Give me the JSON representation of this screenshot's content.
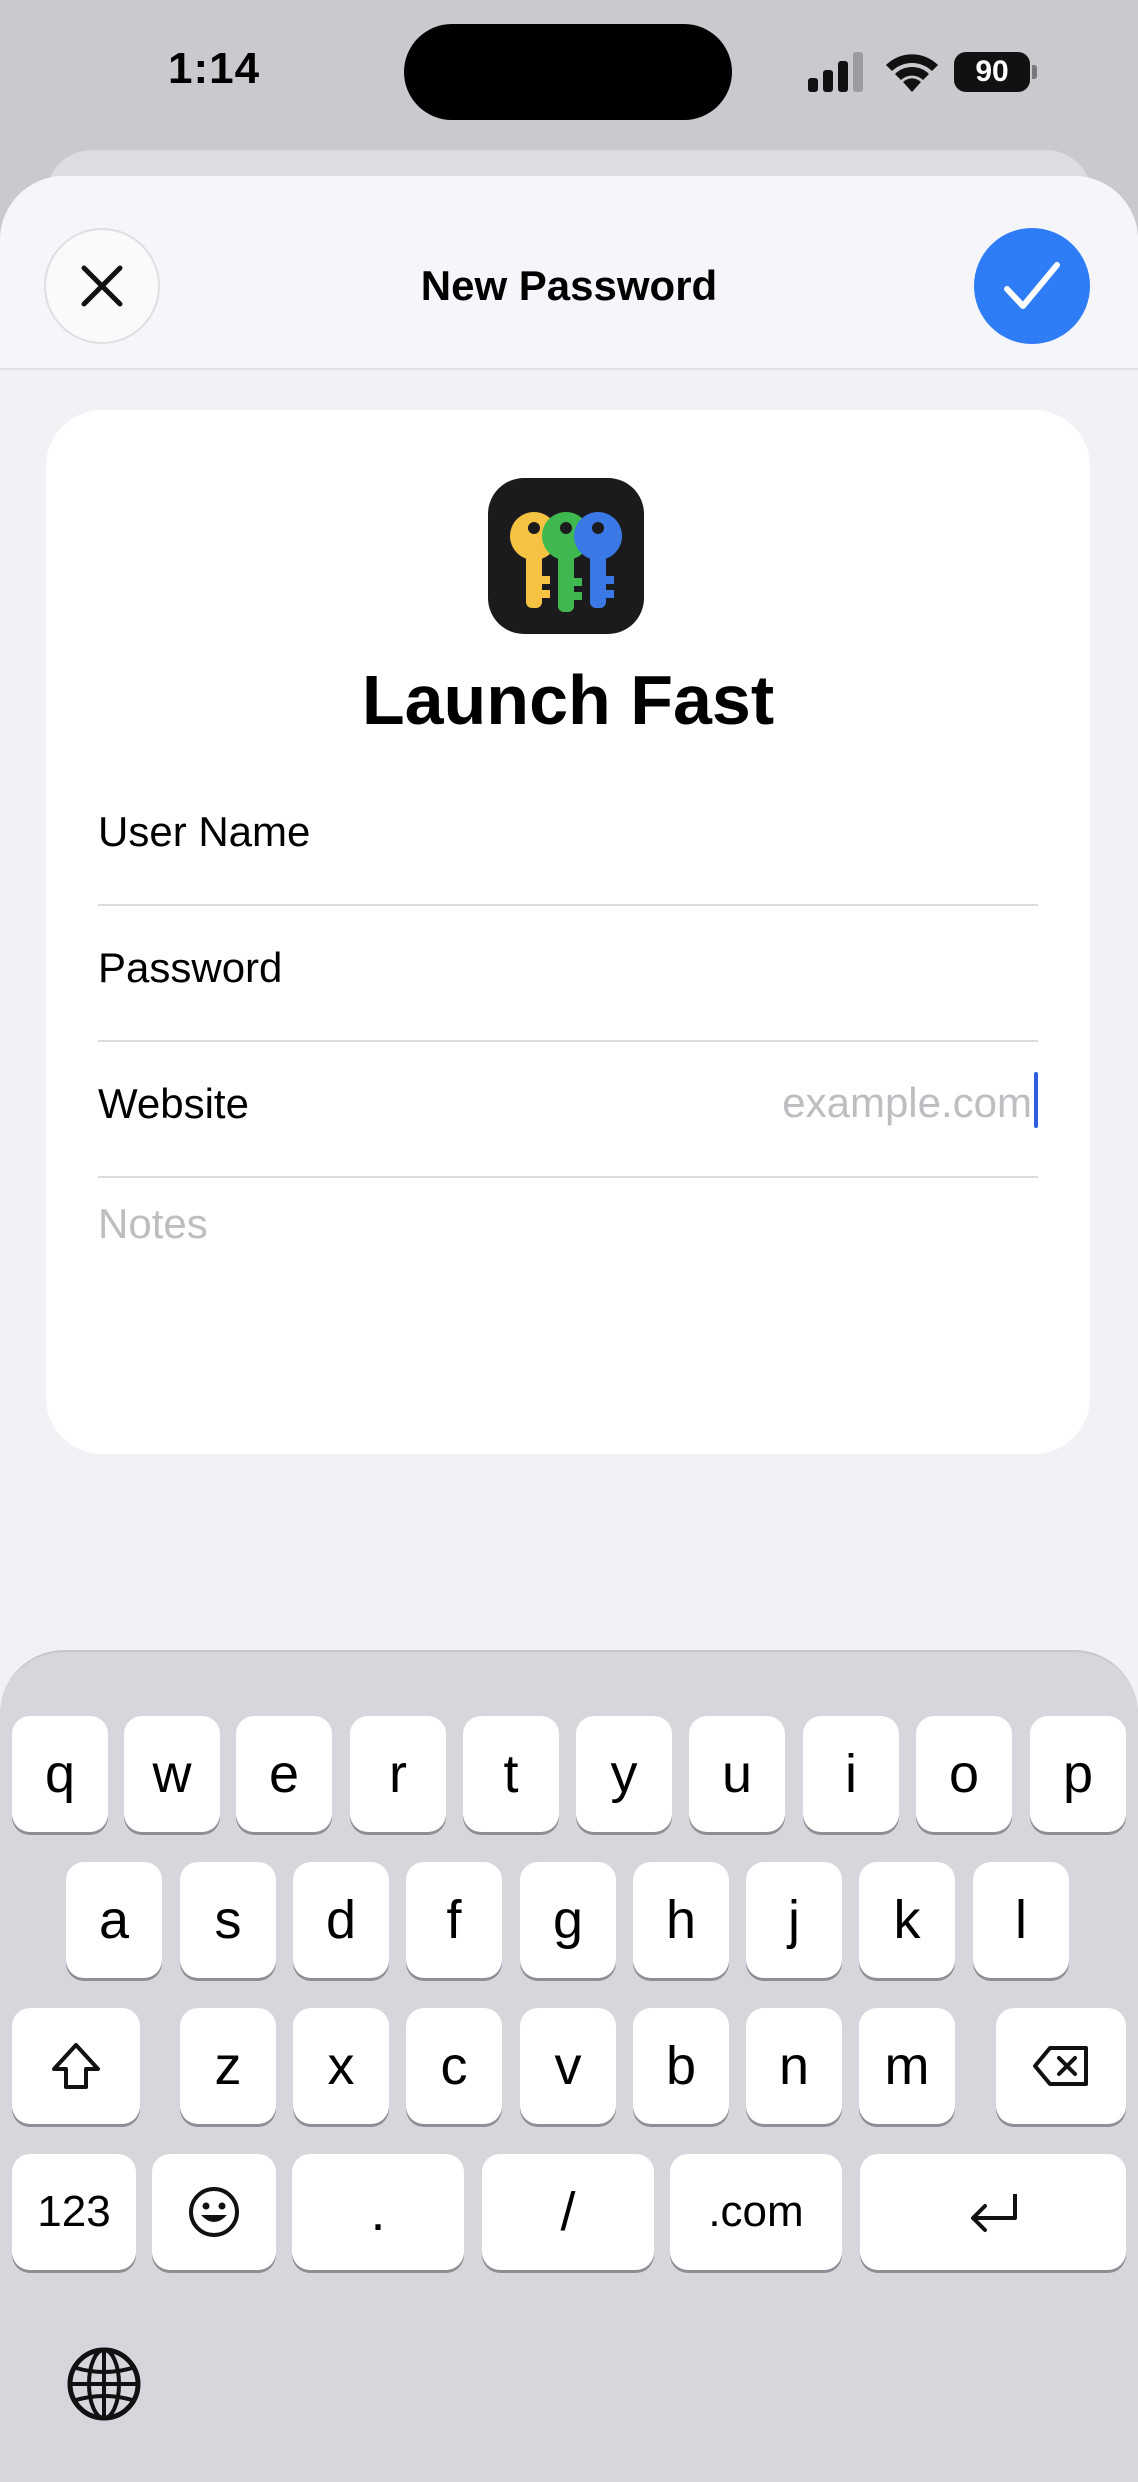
{
  "status_bar": {
    "time": "1:14",
    "battery": "90"
  },
  "sheet": {
    "title": "New Password",
    "close_icon": "close-icon",
    "done_icon": "checkmark-icon",
    "accent": "#2f7df6"
  },
  "card": {
    "app_name": "Launch Fast",
    "fields": [
      {
        "label": "User Name",
        "value": ""
      },
      {
        "label": "Password",
        "value": ""
      },
      {
        "label": "Website",
        "placeholder": "example.com",
        "value": ""
      }
    ],
    "notes_placeholder": "Notes"
  },
  "keyboard": {
    "row1": [
      "q",
      "w",
      "e",
      "r",
      "t",
      "y",
      "u",
      "i",
      "o",
      "p"
    ],
    "row2": [
      "a",
      "s",
      "d",
      "f",
      "g",
      "h",
      "j",
      "k",
      "l"
    ],
    "row3": [
      "z",
      "x",
      "c",
      "v",
      "b",
      "n",
      "m"
    ],
    "bottom": {
      "numbers": "123",
      "period": ".",
      "slash": "/",
      "dotcom": ".com"
    }
  }
}
